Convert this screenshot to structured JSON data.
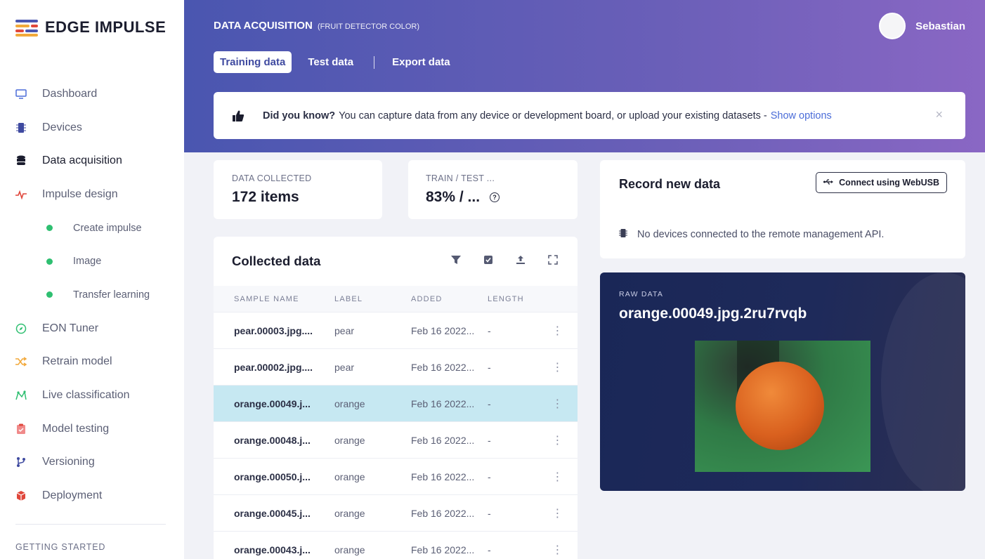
{
  "brand": {
    "name": "EDGE IMPULSE"
  },
  "sidebar": {
    "items": [
      {
        "label": "Dashboard",
        "icon": "monitor-icon"
      },
      {
        "label": "Devices",
        "icon": "chip-icon"
      },
      {
        "label": "Data acquisition",
        "icon": "database-icon"
      },
      {
        "label": "Impulse design",
        "icon": "pulse-icon"
      },
      {
        "label": "Create impulse",
        "icon": "dot-icon"
      },
      {
        "label": "Image",
        "icon": "dot-icon"
      },
      {
        "label": "Transfer learning",
        "icon": "dot-icon"
      },
      {
        "label": "EON Tuner",
        "icon": "compass-icon"
      },
      {
        "label": "Retrain model",
        "icon": "shuffle-icon"
      },
      {
        "label": "Live classification",
        "icon": "graph-icon"
      },
      {
        "label": "Model testing",
        "icon": "clipboard-icon"
      },
      {
        "label": "Versioning",
        "icon": "branch-icon"
      },
      {
        "label": "Deployment",
        "icon": "box-icon"
      }
    ],
    "section": "GETTING STARTED"
  },
  "header": {
    "title": "DATA ACQUISITION",
    "project": "(FRUIT DETECTOR COLOR)",
    "user": "Sebastian",
    "tabs": [
      "Training data",
      "Test data",
      "Export data"
    ]
  },
  "banner": {
    "bold": "Did you know?",
    "text": "You can capture data from any device or development board, or upload your existing datasets -",
    "link": "Show options",
    "close": "×"
  },
  "stats": {
    "collected_label": "DATA COLLECTED",
    "collected_value": "172 items",
    "split_label": "TRAIN / TEST ...",
    "split_value": "83% / ..."
  },
  "collected": {
    "title": "Collected data",
    "columns": [
      "SAMPLE NAME",
      "LABEL",
      "ADDED",
      "LENGTH"
    ],
    "rows": [
      {
        "name": "pear.00003.jpg....",
        "label": "pear",
        "added": "Feb 16 2022...",
        "length": "-"
      },
      {
        "name": "pear.00002.jpg....",
        "label": "pear",
        "added": "Feb 16 2022...",
        "length": "-"
      },
      {
        "name": "orange.00049.j...",
        "label": "orange",
        "added": "Feb 16 2022...",
        "length": "-"
      },
      {
        "name": "orange.00048.j...",
        "label": "orange",
        "added": "Feb 16 2022...",
        "length": "-"
      },
      {
        "name": "orange.00050.j...",
        "label": "orange",
        "added": "Feb 16 2022...",
        "length": "-"
      },
      {
        "name": "orange.00045.j...",
        "label": "orange",
        "added": "Feb 16 2022...",
        "length": "-"
      },
      {
        "name": "orange.00043.j...",
        "label": "orange",
        "added": "Feb 16 2022...",
        "length": "-"
      }
    ],
    "menu_glyph": "⋮"
  },
  "record": {
    "title": "Record new data",
    "button": "Connect using WebUSB",
    "status": "No devices connected to the remote management API."
  },
  "raw": {
    "label": "RAW DATA",
    "name": "orange.00049.jpg.2ru7rvqb"
  },
  "colors": {
    "accent": "#4a56b0",
    "selected_row": "#c6e8f2",
    "dot": "#2fbf71",
    "link": "#4a6cd8"
  }
}
